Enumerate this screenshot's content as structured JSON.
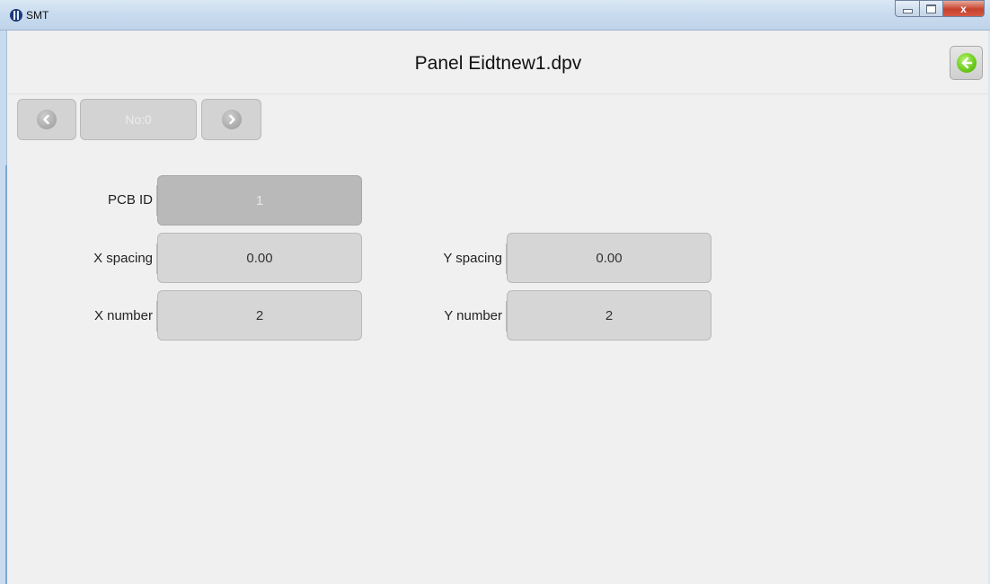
{
  "window": {
    "title": "SMT",
    "controls": {
      "minimize": "",
      "maximize": "",
      "close": "x"
    }
  },
  "header": {
    "title": "Panel Eidtnew1.dpv",
    "back_icon": "green-back-arrow-icon"
  },
  "nav": {
    "prev_icon": "chevron-left-icon",
    "counter": "No:0",
    "next_icon": "chevron-right-icon"
  },
  "form": {
    "pcb_id": {
      "label": "PCB ID",
      "value": "1"
    },
    "x_spacing": {
      "label": "X spacing",
      "value": "0.00"
    },
    "y_spacing": {
      "label": "Y spacing",
      "value": "0.00"
    },
    "x_number": {
      "label": "X number",
      "value": "2"
    },
    "y_number": {
      "label": "Y number",
      "value": "2"
    }
  },
  "colors": {
    "background": "#f0f0f0",
    "field": "#d6d6d6",
    "field_disabled": "#b9b9b9",
    "accent_green": "#6fcf1f"
  }
}
